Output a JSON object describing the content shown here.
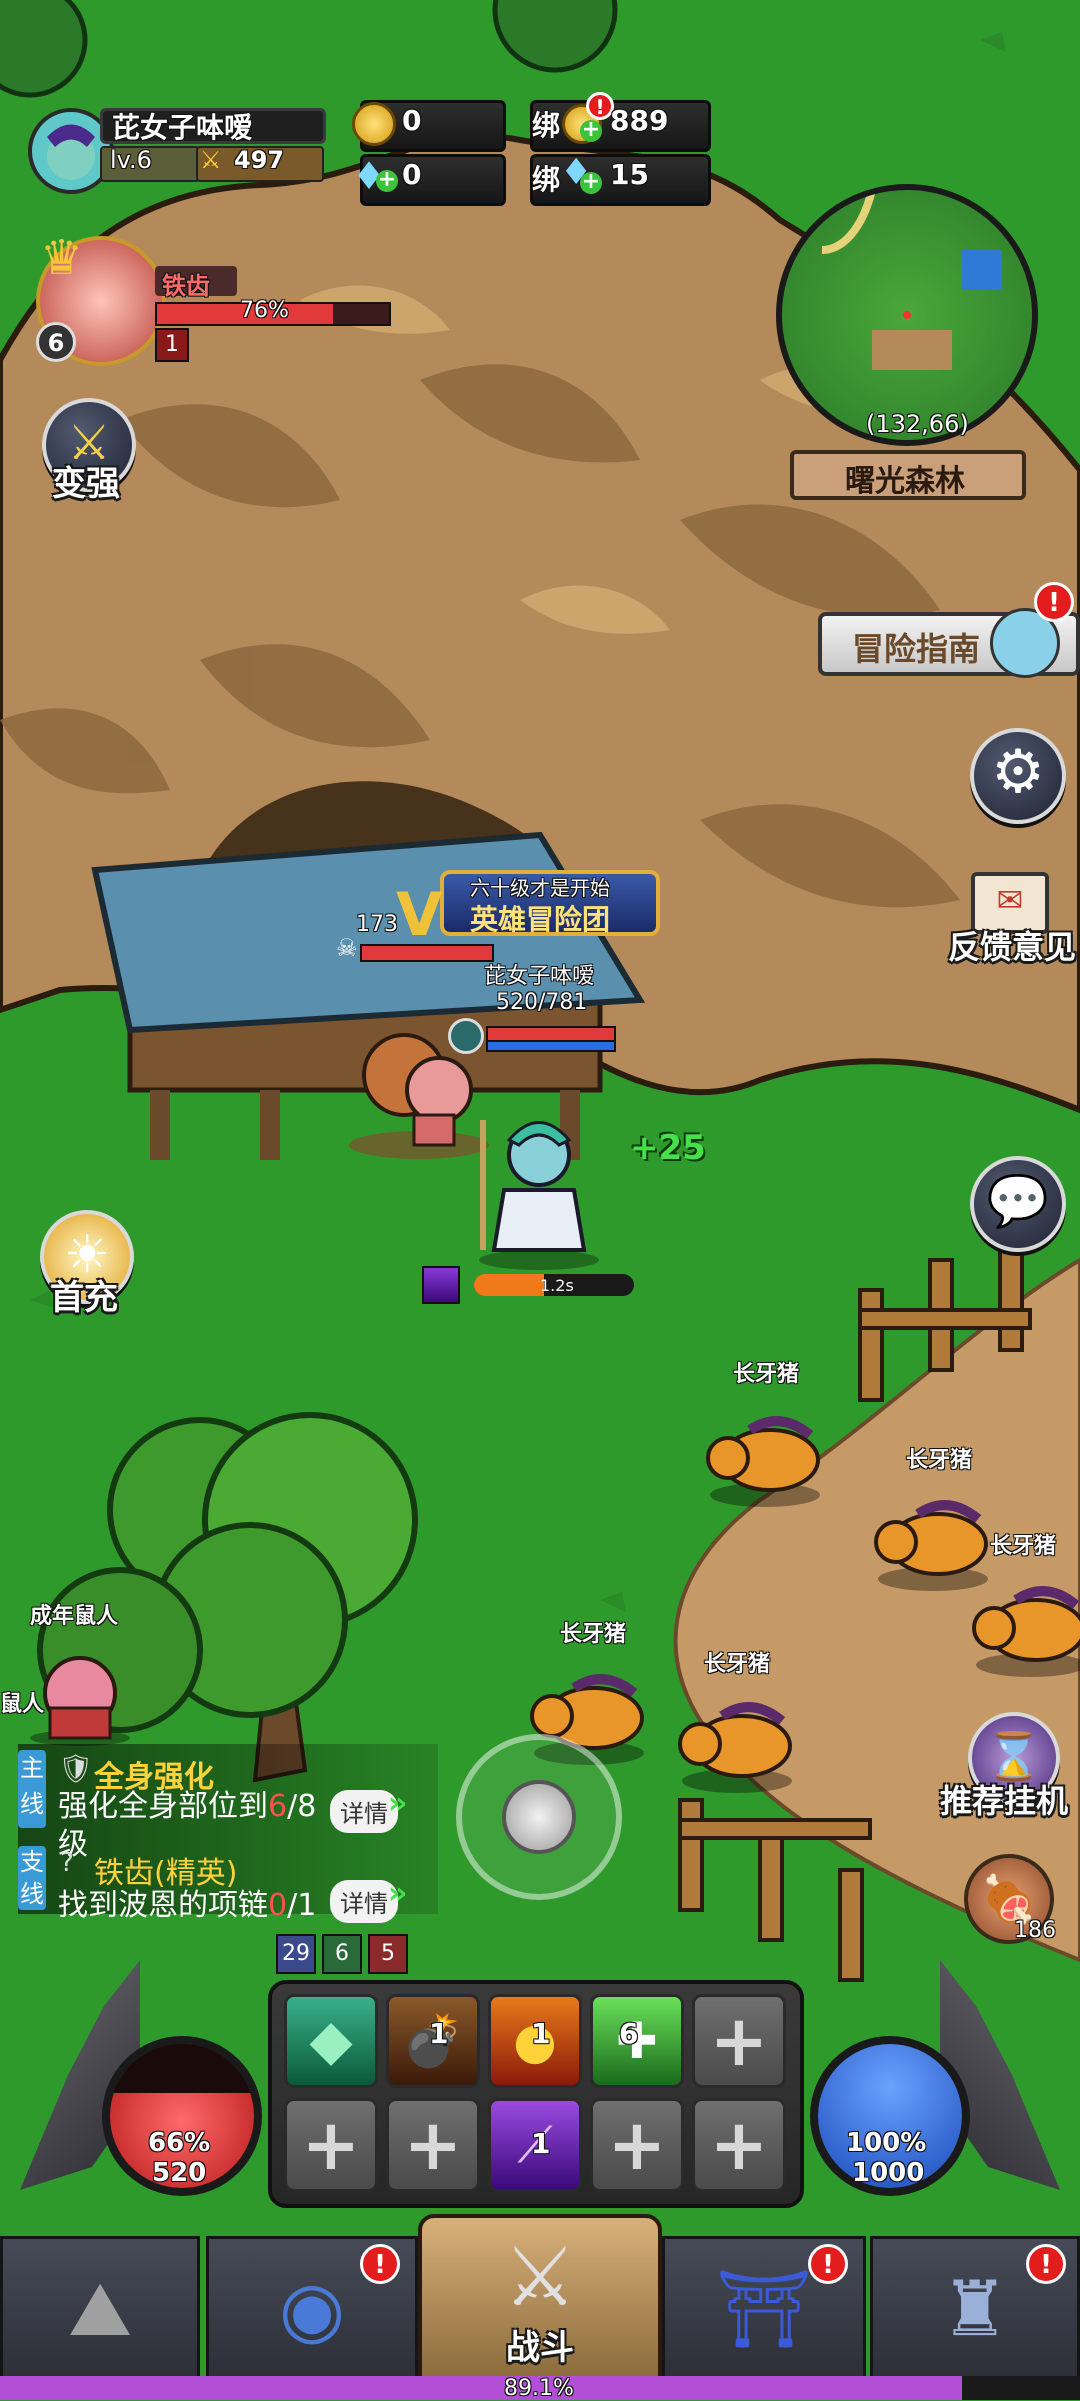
{
  "player": {
    "name": "芘女子呠嗳",
    "level": "lv.6",
    "power": "497"
  },
  "currency": {
    "gold": "0",
    "diamond": "0",
    "bound_gold_label": "绑",
    "bound_gold": "889",
    "bound_diamond_label": "绑",
    "bound_diamond": "15"
  },
  "target": {
    "name": "铁齿",
    "hp_percent_text": "76%",
    "hp_fraction": 0.76,
    "level": "6",
    "buff_count": "1"
  },
  "menu": {
    "strengthen": "变强",
    "first_recharge": "首充",
    "feedback": "反馈意见",
    "guide": "冒险指南",
    "recommend": "推荐挂机"
  },
  "minimap": {
    "coords": "(132,66)",
    "location": "曙光森林"
  },
  "event_banner": {
    "line1": "六十级才是开始",
    "line2": "英雄冒险团"
  },
  "hero": {
    "name": "芘女子呠嗳",
    "hp": "520/781",
    "heal": "+25",
    "cast_time": "1.2s"
  },
  "boss_bar": {
    "value": "173"
  },
  "enemies": [
    {
      "name": "长牙猪"
    },
    {
      "name": "长牙猪"
    },
    {
      "name": "长牙猪"
    },
    {
      "name": "长牙猪"
    },
    {
      "name": "长牙猪"
    },
    {
      "name": "成年鼠人"
    },
    {
      "name": "鼠人"
    }
  ],
  "quests": [
    {
      "tag": "主线",
      "title": "全身强化",
      "desc_pre": "强化全身部位到",
      "current": "6",
      "sep": "/",
      "total": "8",
      "desc_post": "级",
      "detail": "详情"
    },
    {
      "tag": "支线",
      "title": "铁齿(精英)",
      "desc_pre": "找到波恩的项链",
      "current": "0",
      "sep": "/",
      "total": "1",
      "detail": "详情"
    }
  ],
  "buffs": [
    "29",
    "6",
    "5"
  ],
  "skill_slots_row1": [
    {
      "icon": "green-crystal-icon",
      "count": ""
    },
    {
      "icon": "bomb-icon",
      "count": "1"
    },
    {
      "icon": "fire-orb-icon",
      "count": "1"
    },
    {
      "icon": "heal-potion-icon",
      "count": "6"
    },
    {
      "icon": "plus-icon",
      "count": ""
    }
  ],
  "skill_slots_row2": [
    {
      "icon": "plus-icon",
      "count": ""
    },
    {
      "icon": "plus-icon",
      "count": ""
    },
    {
      "icon": "purple-rune-icon",
      "count": "1"
    },
    {
      "icon": "plus-icon",
      "count": ""
    },
    {
      "icon": "plus-icon",
      "count": ""
    }
  ],
  "hp_orb": {
    "percent": "66%",
    "value": "520",
    "fraction": 0.66
  },
  "mp_orb": {
    "percent": "100%",
    "value": "1000",
    "fraction": 1.0
  },
  "bag": {
    "count": "186"
  },
  "nav": {
    "battle": "战斗"
  },
  "exp": {
    "text": "89.1%",
    "fraction": 0.891
  },
  "colors": {
    "grass": "#2f9a2c",
    "hp_red": "#e23a3a",
    "mp_blue": "#2b6de0",
    "exp_purple": "#b24fd6",
    "highlight_red": "#ff5050"
  }
}
